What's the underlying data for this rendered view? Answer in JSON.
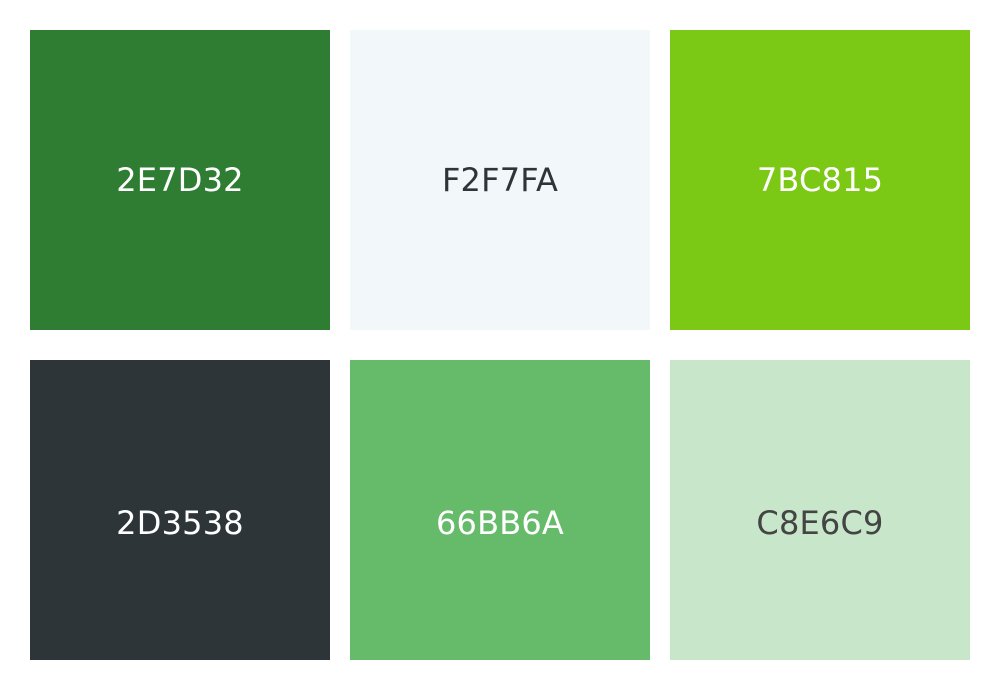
{
  "palette": {
    "swatches": [
      {
        "label": "2E7D32",
        "color": "#2E7D32",
        "text_color": "#FFFFFF"
      },
      {
        "label": "F2F7FA",
        "color": "#F2F7FA",
        "text_color": "#2D3538"
      },
      {
        "label": "7BC815",
        "color": "#7BC815",
        "text_color": "#FFFFFF"
      },
      {
        "label": "2D3538",
        "color": "#2D3538",
        "text_color": "#FFFFFF"
      },
      {
        "label": "66BB6A",
        "color": "#66BB6A",
        "text_color": "#FFFFFF"
      },
      {
        "label": "C8E6C9",
        "color": "#C8E6C9",
        "text_color": "#444444"
      }
    ]
  }
}
